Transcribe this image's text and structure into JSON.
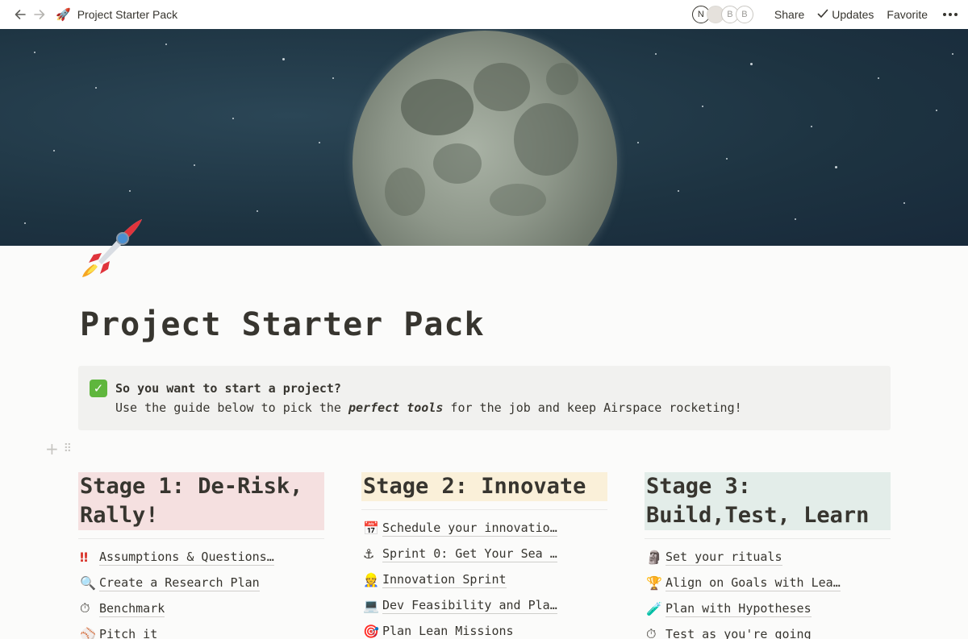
{
  "topbar": {
    "breadcrumb_icon": "rocket-icon",
    "breadcrumb_title": "Project Starter Pack",
    "avatars": [
      "N",
      "",
      "B",
      "B"
    ],
    "share": "Share",
    "updates": "Updates",
    "favorite": "Favorite"
  },
  "page": {
    "icon": "rocket-icon",
    "title": "Project Starter Pack"
  },
  "callout": {
    "icon": "check-mark-icon",
    "heading": "So you want to start a project?",
    "text_before": "Use the guide below to pick the ",
    "text_emphasis": "perfect tools",
    "text_after": " for the job and keep Airspace rocketing!"
  },
  "columns": [
    {
      "stage": "Stage 1: De-Risk, Rally!",
      "color": "#f5e0e0",
      "items": [
        {
          "icon": "double-exclamation-icon",
          "label": "Assumptions & Questions…"
        },
        {
          "icon": "magnifier-icon",
          "label": "Create a Research Plan"
        },
        {
          "icon": "stopwatch-icon",
          "label": "Benchmark"
        },
        {
          "icon": "baseball-icon",
          "label": "Pitch it"
        }
      ]
    },
    {
      "stage": "Stage 2: Innovate",
      "color": "#faf0d9",
      "items": [
        {
          "icon": "calendar-icon",
          "label": "Schedule your innovatio…"
        },
        {
          "icon": "anchor-icon",
          "label": "Sprint 0: Get Your Sea …"
        },
        {
          "icon": "person-icon",
          "label": "Innovation Sprint"
        },
        {
          "icon": "laptop-icon",
          "label": "Dev Feasibility and Pla…"
        },
        {
          "icon": "target-icon",
          "label": "Plan Lean Missions"
        }
      ]
    },
    {
      "stage": "Stage 3: Build,Test, Learn",
      "color": "#e3ede9",
      "items": [
        {
          "icon": "moai-icon",
          "label": "Set your rituals"
        },
        {
          "icon": "trophy-icon",
          "label": "Align on Goals with Lea…"
        },
        {
          "icon": "test-tube-icon",
          "label": "Plan with Hypotheses"
        },
        {
          "icon": "stopwatch-icon",
          "label": "Test as you're going"
        }
      ]
    }
  ]
}
